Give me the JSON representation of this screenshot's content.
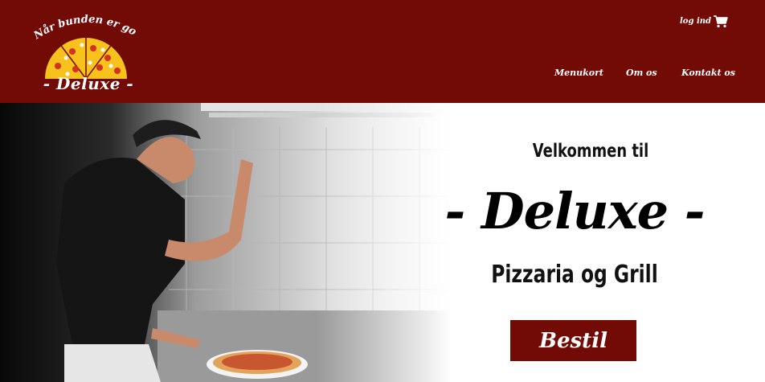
{
  "logo": {
    "tagline": "Når bunden er god",
    "name": "- Deluxe -"
  },
  "header": {
    "login_label": "log ind",
    "cart_icon": "cart-icon"
  },
  "nav": {
    "items": [
      {
        "label": "Menukort"
      },
      {
        "label": "Om os"
      },
      {
        "label": "Kontakt os"
      }
    ]
  },
  "hero": {
    "welcome": "Velkommen til",
    "brand": "- Deluxe -",
    "subtitle": "Pizzaria og Grill",
    "order_button": "Bestil"
  },
  "colors": {
    "brand": "#720a05",
    "text": "#000000",
    "background": "#ffffff"
  }
}
